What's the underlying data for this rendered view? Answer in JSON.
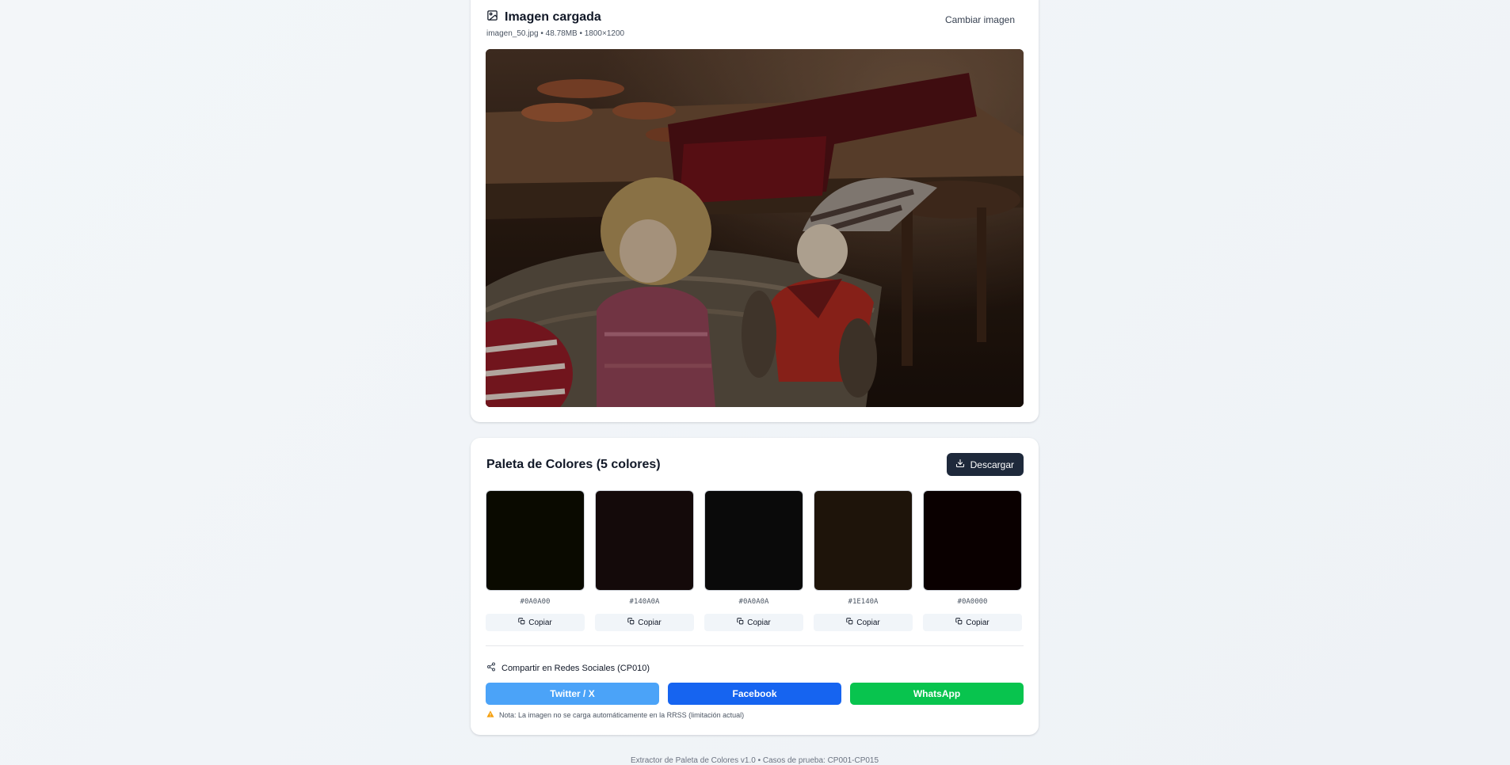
{
  "image_card": {
    "title": "Imagen cargada",
    "meta": "imagen_50.jpg • 48.78MB • 1800×1200",
    "change_label": "Cambiar imagen"
  },
  "palette": {
    "title": "Paleta de Colores (5 colores)",
    "download_label": "Descargar",
    "colors": [
      {
        "hex": "#0A0A00",
        "copy_label": "Copiar"
      },
      {
        "hex": "#140A0A",
        "copy_label": "Copiar"
      },
      {
        "hex": "#0A0A0A",
        "copy_label": "Copiar"
      },
      {
        "hex": "#1E140A",
        "copy_label": "Copiar"
      },
      {
        "hex": "#0A0000",
        "copy_label": "Copiar"
      }
    ]
  },
  "share": {
    "label": "Compartir en Redes Sociales (CP010)",
    "twitter": "Twitter / X",
    "facebook": "Facebook",
    "whatsapp": "WhatsApp",
    "note": "Nota: La imagen no se carga automáticamente en la RRSS (limitación actual)"
  },
  "footer": "Extractor de Paleta de Colores v1.0 • Casos de prueba: CP001-CP015",
  "colors": {
    "twitter": "#4ba3f8",
    "facebook": "#1664f0",
    "whatsapp": "#08c44e",
    "download_bg": "#1e293b"
  }
}
